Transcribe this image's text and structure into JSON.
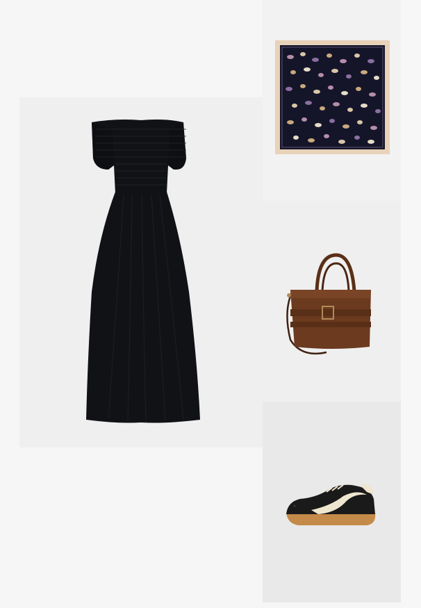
{
  "collage": {
    "items": [
      {
        "id": "dress",
        "label": "",
        "icon": "black-smocked-maxi-dress"
      },
      {
        "id": "scarf",
        "label": "",
        "icon": "printed-silk-scarf"
      },
      {
        "id": "bag",
        "label": "",
        "icon": "brown-suede-handbag"
      },
      {
        "id": "sneaker",
        "label": "",
        "icon": "black-cream-sneaker"
      }
    ]
  },
  "colors": {
    "page_bg": "#f6f6f6",
    "dress": "#111216",
    "scarf_bg": "#15152a",
    "scarf_border": "#e8d2b9",
    "bag": "#6b3a1f",
    "sneaker_upper": "#1a1a1a",
    "sneaker_stripe": "#efe6cf",
    "sneaker_sole": "#c48a4a"
  }
}
